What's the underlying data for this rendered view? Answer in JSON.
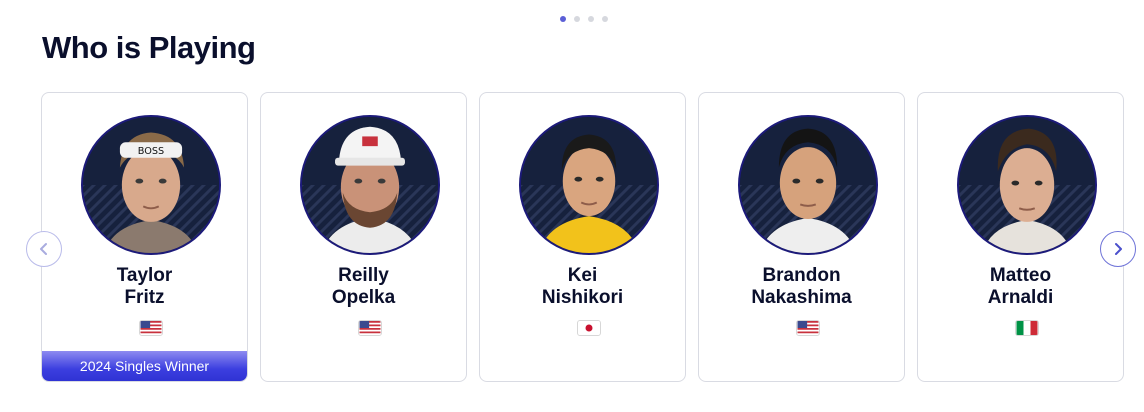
{
  "section": {
    "title": "Who is Playing"
  },
  "pagination": {
    "count": 4,
    "active": 0
  },
  "players": [
    {
      "first": "Taylor",
      "last": "Fritz",
      "flag": "us-flag-icon",
      "badge": "2024 Singles Winner"
    },
    {
      "first": "Reilly",
      "last": "Opelka",
      "flag": "us-flag-icon"
    },
    {
      "first": "Kei",
      "last": "Nishikori",
      "flag": "japan-flag-icon"
    },
    {
      "first": "Brandon",
      "last": "Nakashima",
      "flag": "us-flag-icon"
    },
    {
      "first": "Matteo",
      "last": "Arnaldi",
      "flag": "italy-flag-icon"
    }
  ],
  "nav": {
    "prev_icon": "chevron-left-icon",
    "next_icon": "chevron-right-icon"
  },
  "colors": {
    "accent": "#3c3fe0",
    "avatar_bg": "#16213d",
    "avatar_ring": "#1c1a7a"
  }
}
